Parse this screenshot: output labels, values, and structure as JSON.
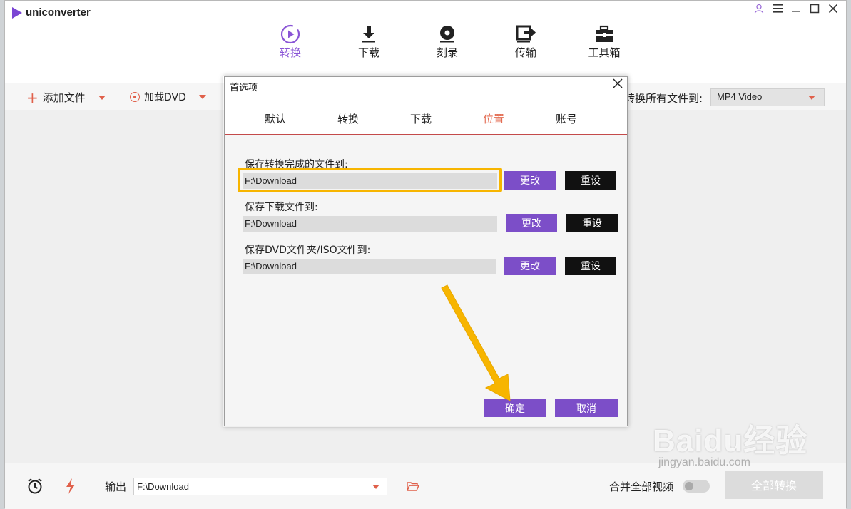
{
  "app": {
    "name": "uniconverter",
    "window_controls": [
      "user-icon",
      "menu-icon",
      "minimize-icon",
      "maximize-icon",
      "close-icon"
    ]
  },
  "nav": {
    "items": [
      {
        "label": "转换",
        "icon": "convert-icon",
        "active": true
      },
      {
        "label": "下载",
        "icon": "download-icon",
        "active": false
      },
      {
        "label": "刻录",
        "icon": "burn-icon",
        "active": false
      },
      {
        "label": "传输",
        "icon": "transfer-icon",
        "active": false
      },
      {
        "label": "工具箱",
        "icon": "toolbox-icon",
        "active": false
      }
    ]
  },
  "toolbar": {
    "add_files": "添加文件",
    "load_dvd": "加载DVD",
    "convert_all_to": "转换所有文件到:",
    "format": "MP4 Video"
  },
  "dialog": {
    "title": "首选项",
    "tabs": [
      "默认",
      "转换",
      "下载",
      "位置",
      "账号"
    ],
    "active_tab": "位置",
    "rows": [
      {
        "label": "保存转换完成的文件到:",
        "path": "F:\\Download",
        "change": "更改",
        "reset": "重设"
      },
      {
        "label": "保存下载文件到:",
        "path": "F:\\Download",
        "change": "更改",
        "reset": "重设"
      },
      {
        "label": "保存DVD文件夹/ISO文件到:",
        "path": "F:\\Download",
        "change": "更改",
        "reset": "重设"
      }
    ],
    "ok": "确定",
    "cancel": "取消"
  },
  "bottom": {
    "output_label": "输出",
    "output_path": "F:\\Download",
    "merge_label": "合并全部视频",
    "convert_all": "全部转换"
  },
  "watermark": {
    "brand": "Baidu经验",
    "url": "jingyan.baidu.com"
  },
  "colors": {
    "accent_purple": "#7c4ec8",
    "accent_orange": "#e0604a",
    "tab_underline": "#c44a4a",
    "highlight": "#f7b500"
  }
}
